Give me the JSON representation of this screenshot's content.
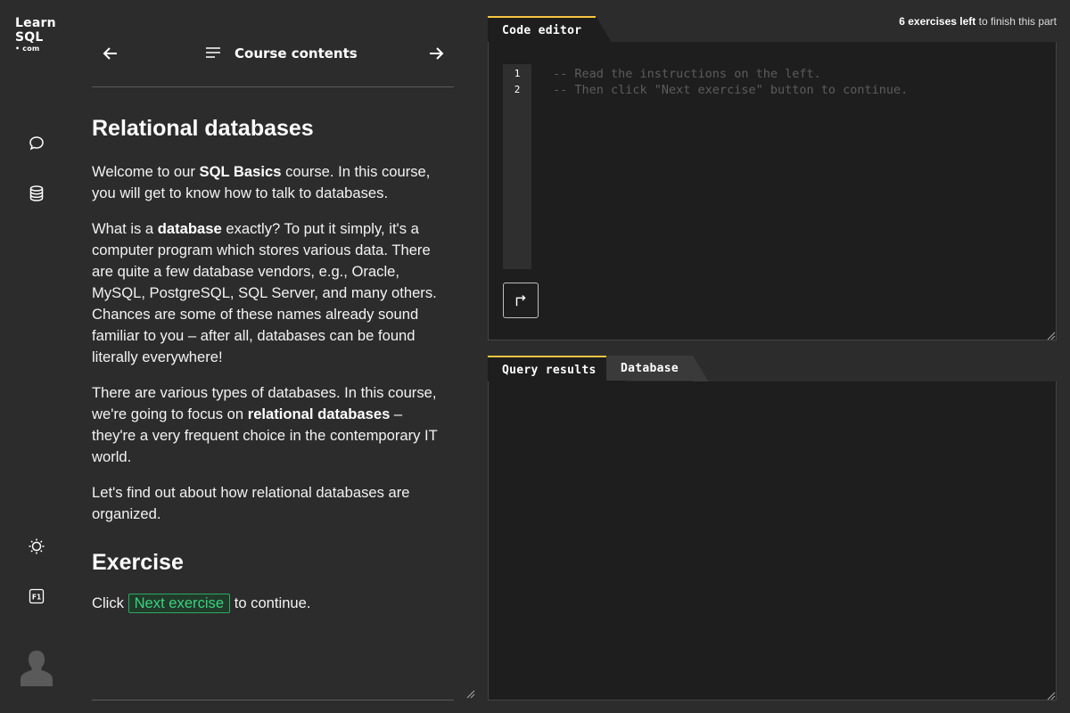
{
  "logo": {
    "line1": "Learn",
    "line2": "SQL",
    "line3": "• com"
  },
  "nav": {
    "course_contents": "Course contents"
  },
  "lesson": {
    "title": "Relational databases",
    "p1": {
      "a": "Welcome to our ",
      "b": "SQL Basics",
      "c": " course. In this course, you will get to know how to talk to databases."
    },
    "p2": {
      "a": "What is a ",
      "b": "database",
      "c": " exactly? To put it simply, it's a computer program which stores various data. There are quite a few database vendors, e.g., Oracle, MySQL, PostgreSQL, SQL Server, and many others. Chances are some of these names already sound familiar to you – after all, databases can be found literally everywhere!"
    },
    "p3": {
      "a": "There are various types of databases. In this course, we're going to focus on ",
      "b": "relational databases",
      "c": " – they're a very frequent choice in the contemporary IT world."
    },
    "p4": "Let's find out about how relational databases are organized.",
    "exercise_title": "Exercise",
    "exercise": {
      "a": "Click ",
      "button": "Next exercise",
      "c": " to continue."
    }
  },
  "progress": {
    "bold": "6 exercises left",
    "rest": " to finish this part"
  },
  "editor": {
    "tab": "Code editor",
    "line_numbers": [
      "1",
      "2"
    ],
    "lines": [
      "-- Read the instructions on the left.",
      "-- Then click \"Next exercise\" button to continue."
    ]
  },
  "results": {
    "tab_results": "Query results",
    "tab_database": "Database"
  },
  "colors": {
    "background": "#2c2c2c",
    "panel": "#1e1e1e",
    "accent_tab": "#f5c542",
    "link_green": "#3ad27e"
  },
  "icons": {
    "chat": "chat-bubble-icon",
    "database": "database-icon",
    "theme": "sun-icon",
    "help": "f1-key-icon",
    "avatar": "user-avatar-icon",
    "prev": "arrow-left-icon",
    "next": "arrow-right-icon",
    "contents": "list-icon",
    "run": "run-arrow-icon"
  }
}
